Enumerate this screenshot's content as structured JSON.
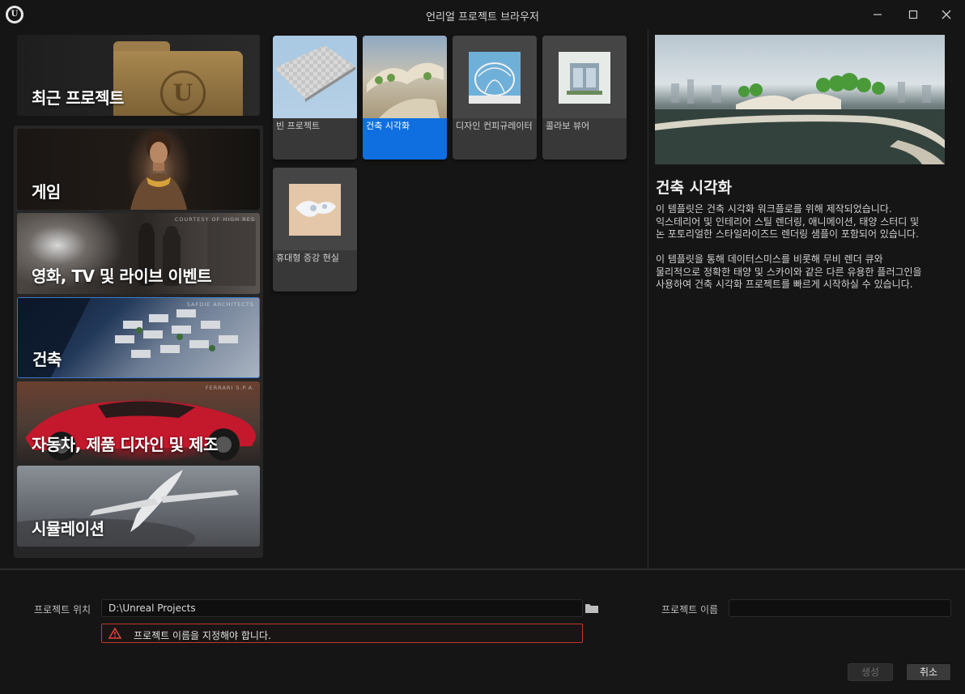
{
  "window": {
    "title": "언리얼 프로젝트 브라우저",
    "logo_text": "U",
    "minimize_glyph": "—",
    "maximize_glyph": "☐",
    "close_glyph": "✕"
  },
  "categories": {
    "recent": "최근 프로젝트",
    "game": "게임",
    "film": "영화, TV 및 라이브 이벤트",
    "film_credit": "COURTESY OF HIGH RES",
    "architecture": "건축",
    "architecture_credit": "SAFDIE ARCHITECTS",
    "automotive": "자동차, 제품 디자인 및 제조",
    "automotive_credit": "FERRARI S.P.A.",
    "simulation": "시뮬레이션"
  },
  "templates": {
    "blank": "빈 프로젝트",
    "archviz": "건축 시각화",
    "design_config": "디자인 컨피규레이터",
    "collab_viewer": "콜라보 뷰어",
    "handheld_ar": "휴대형 증강 현실"
  },
  "description": {
    "title": "건축 시각화",
    "body": "이 템플릿은 건축 시각화 워크플로를 위해 제작되었습니다.\n익스테리어 및 인테리어 스틸 렌더링, 애니메이션, 태양 스터디 및\n논 포토리얼한 스타일라이즈드 렌더링 샘플이 포함되어 있습니다.\n\n이 템플릿을 통해 데이터스미스를 비롯해 무비 렌더 큐와\n물리적으로 정확한 태양 및 스카이와 같은 다른 유용한 플러그인을\n사용하여 건축 시각화 프로젝트를 빠르게 시작하실 수 있습니다."
  },
  "bottom": {
    "location_label": "프로젝트 위치",
    "location_value": "D:\\Unreal Projects",
    "name_label": "프로젝트 이름",
    "name_value": "",
    "error_message": "프로젝트 이름을 지정해야 합니다.",
    "create_button": "생성",
    "cancel_button": "취소"
  },
  "colors": {
    "selection": "#0f6fe0",
    "error_border": "#c0392b",
    "background": "#151515"
  }
}
